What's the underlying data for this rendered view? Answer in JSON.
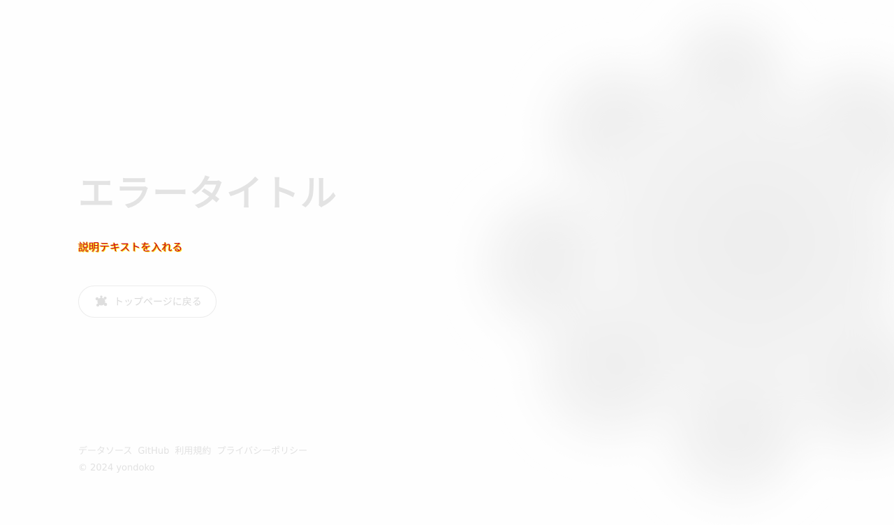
{
  "error": {
    "title": "エラータイトル",
    "description": "説明テキストを入れる"
  },
  "back_button": {
    "label": "トップページに戻る",
    "icon": "splat-icon"
  },
  "footer": {
    "links": [
      {
        "label": "データソース"
      },
      {
        "label": "GitHub"
      },
      {
        "label": "利用規約"
      },
      {
        "label": "プライバシーポリシー"
      }
    ],
    "copyright": "© 2024 yondoko"
  },
  "colors": {
    "background": "#fefefe",
    "title": "#e3e3e3",
    "description": "#c8002a",
    "description_outline": "#ffe600",
    "muted_text": "#e2e2e2",
    "blob": "#f0f0f0"
  }
}
